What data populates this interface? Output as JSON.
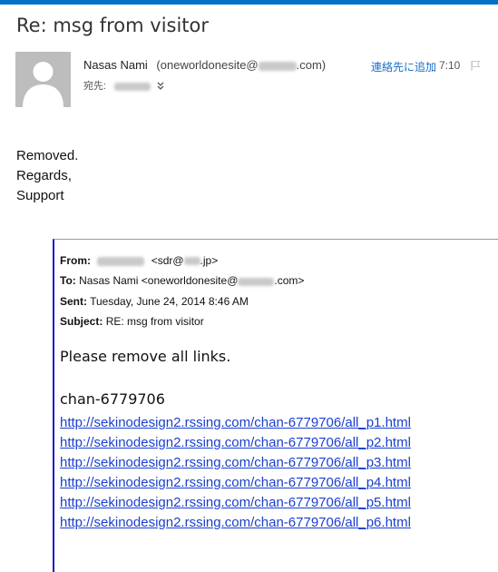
{
  "email": {
    "subject": "Re: msg from visitor",
    "sender_name": "Nasas Nami",
    "sender_email_prefix": "(oneworldonesite@",
    "sender_email_suffix": ".com)",
    "add_contact_label": "連絡先に追加",
    "time": "7:10",
    "recipient_label": "宛先:",
    "body_lines": [
      "Removed.",
      "Regards,",
      "Support"
    ]
  },
  "quoted": {
    "from_label": "From:",
    "from_value_prefix": "<sdr@",
    "from_value_suffix": ".jp>",
    "to_label": "To:",
    "to_value_prefix": "Nasas Nami <oneworldonesite@",
    "to_value_suffix": ".com>",
    "sent_label": "Sent:",
    "sent_value": "Tuesday, June 24, 2014 8:46 AM",
    "subject_label": "Subject:",
    "subject_value": "RE: msg from visitor",
    "body": "Please remove all links.",
    "channel": "chan-6779706",
    "links": [
      "http://sekinodesign2.rssing.com/chan-6779706/all_p1.html",
      "http://sekinodesign2.rssing.com/chan-6779706/all_p2.html",
      "http://sekinodesign2.rssing.com/chan-6779706/all_p3.html",
      "http://sekinodesign2.rssing.com/chan-6779706/all_p4.html",
      "http://sekinodesign2.rssing.com/chan-6779706/all_p5.html",
      "http://sekinodesign2.rssing.com/chan-6779706/all_p6.html"
    ]
  },
  "colors": {
    "accent": "#0072c6",
    "link": "#1a3fd0",
    "quote_border": "#1a1ac8"
  },
  "icons": {
    "avatar": "person-silhouette-icon",
    "flag": "flag-icon",
    "expand": "double-chevron-down-icon"
  }
}
